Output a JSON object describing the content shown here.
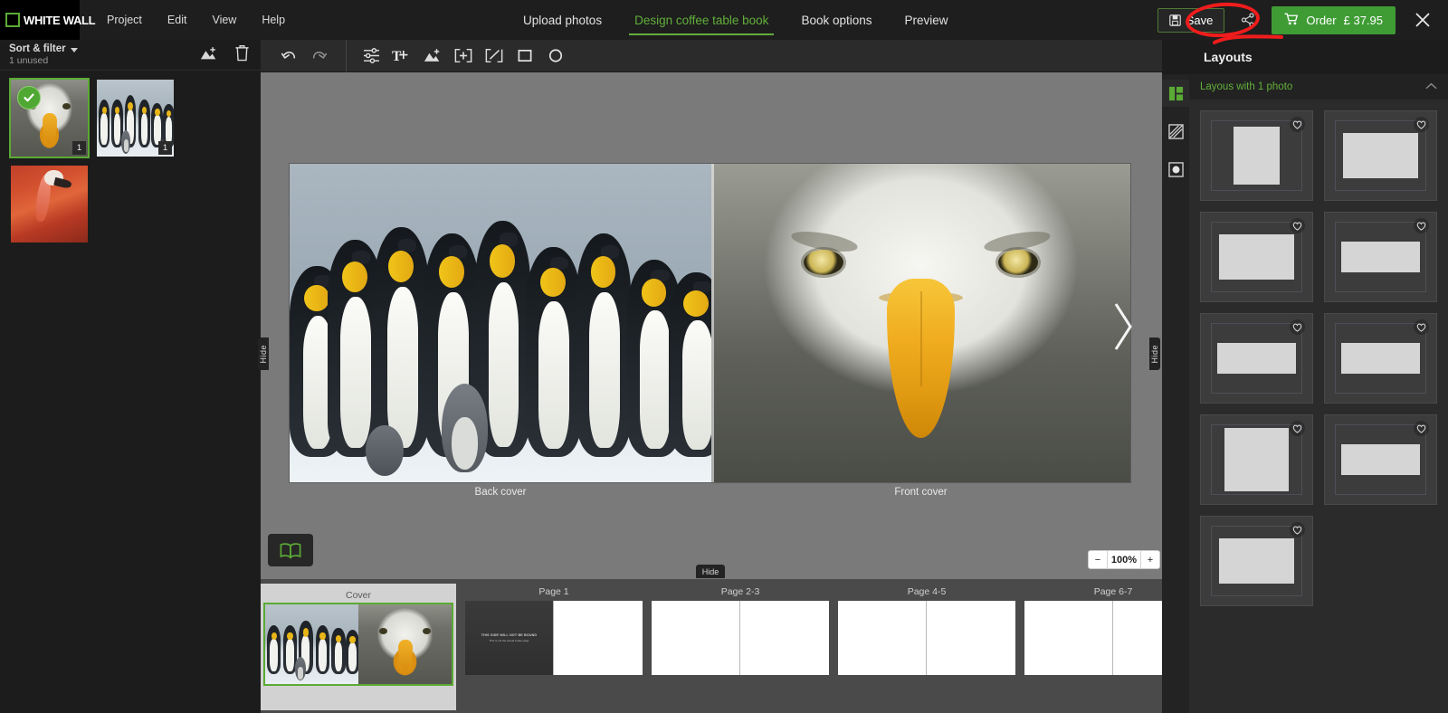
{
  "app": {
    "brand": "WHITE WALL",
    "accent_green": "#5aaa34",
    "order_green": "#3f9c35",
    "annotation_color": "#f01c1c"
  },
  "menu": [
    {
      "label": "Project"
    },
    {
      "label": "Edit"
    },
    {
      "label": "View"
    },
    {
      "label": "Help"
    }
  ],
  "tabs": [
    {
      "label": "Upload photos",
      "active": false
    },
    {
      "label": "Design coffee table book",
      "active": true
    },
    {
      "label": "Book options",
      "active": false
    },
    {
      "label": "Preview",
      "active": false
    }
  ],
  "header_actions": {
    "save_label": "Save",
    "order_label": "Order",
    "order_price": "£ 37.95",
    "save_icon": "save-disk-icon",
    "share_icon": "share-icon",
    "cart_icon": "shopping-cart-icon",
    "close_icon": "close-icon"
  },
  "left_panel": {
    "sort_filter_label": "Sort & filter",
    "unused_label": "1 unused",
    "add_photos_icon": "add-image-icon",
    "delete_icon": "trash-icon",
    "thumbnails": [
      {
        "name": "eagle",
        "selected": true,
        "checked": true,
        "count": "1"
      },
      {
        "name": "penguins",
        "selected": false,
        "checked": false,
        "count": "1"
      },
      {
        "name": "flamingo",
        "selected": false,
        "checked": false,
        "count": ""
      }
    ]
  },
  "toolbar": {
    "items": [
      {
        "icon": "undo-icon",
        "label": "Undo"
      },
      {
        "icon": "redo-icon",
        "label": "Redo"
      },
      {
        "icon": "adjust-sliders-icon",
        "label": "Adjustments"
      },
      {
        "icon": "add-text-icon",
        "label": "Add text"
      },
      {
        "icon": "add-image-icon",
        "label": "Add image"
      },
      {
        "icon": "add-placeholder-icon",
        "label": "Add placeholder"
      },
      {
        "icon": "edit-frame-icon",
        "label": "Edit frame"
      },
      {
        "icon": "rectangle-icon",
        "label": "Rectangle"
      },
      {
        "icon": "ellipse-icon",
        "label": "Ellipse"
      }
    ]
  },
  "canvas": {
    "back_cover_label": "Back cover",
    "front_cover_label": "Front cover",
    "next_arrow_icon": "chevron-right-icon",
    "book_view_icon": "open-book-icon",
    "zoom": {
      "minus": "−",
      "value": "100%",
      "plus": "+"
    },
    "hide_left_label": "Hide",
    "hide_right_label": "Hide",
    "hide_bottom_label": "Hide"
  },
  "filmstrip": {
    "items": [
      {
        "label": "Cover",
        "type": "cover",
        "selected": true
      },
      {
        "label": "Page 1",
        "type": "spread",
        "left_dark": true
      },
      {
        "label": "Page 2-3",
        "type": "spread",
        "left_dark": false
      },
      {
        "label": "Page 4-5",
        "type": "spread",
        "left_dark": false
      },
      {
        "label": "Page 6-7",
        "type": "spread",
        "left_dark": false
      }
    ],
    "no_bind_line1": "THIS SIDE WILL NOT BE BOUND",
    "no_bind_line2": "This is not the actual inside page"
  },
  "right_panel": {
    "title": "Layouts",
    "section_label": "Layous with 1 photo",
    "collapse_icon": "chevron-up-icon",
    "rail": [
      {
        "icon": "layouts-icon",
        "active": true
      },
      {
        "icon": "backgrounds-icon",
        "active": false
      },
      {
        "icon": "masks-icon",
        "active": false
      }
    ],
    "layout_cards": [
      {
        "shape": "portrait",
        "favorite_icon": "heart-icon"
      },
      {
        "shape": "landscape",
        "favorite_icon": "heart-icon"
      },
      {
        "shape": "landscape-small",
        "favorite_icon": "heart-icon"
      },
      {
        "shape": "wide",
        "favorite_icon": "heart-icon"
      },
      {
        "shape": "wide-short",
        "favorite_icon": "heart-icon"
      },
      {
        "shape": "wide-short-2",
        "favorite_icon": "heart-icon"
      },
      {
        "shape": "landscape-2",
        "favorite_icon": "heart-icon"
      },
      {
        "shape": "wide-2",
        "favorite_icon": "heart-icon"
      },
      {
        "shape": "landscape-3",
        "favorite_icon": "heart-icon"
      }
    ]
  }
}
